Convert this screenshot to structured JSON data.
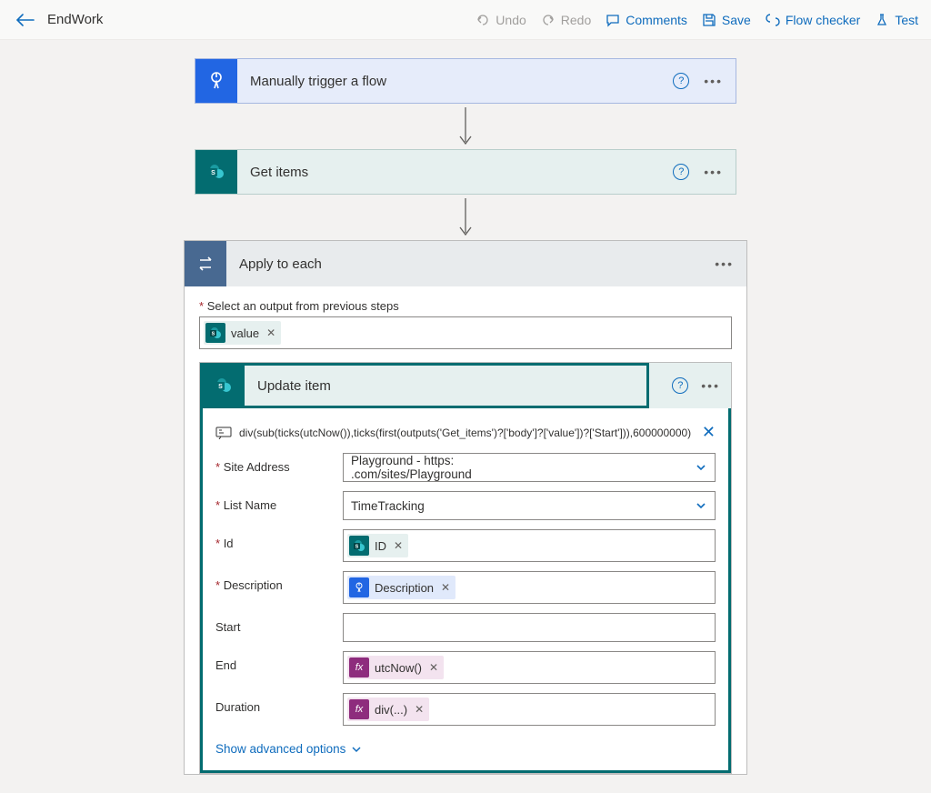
{
  "header": {
    "flow_name": "EndWork",
    "undo": "Undo",
    "redo": "Redo",
    "comments": "Comments",
    "save": "Save",
    "flow_checker": "Flow checker",
    "test": "Test"
  },
  "trigger": {
    "title": "Manually trigger a flow"
  },
  "get_items": {
    "title": "Get items"
  },
  "apply_each": {
    "title": "Apply to each",
    "select_label": "Select an output from previous steps",
    "value_token": "value"
  },
  "update_item": {
    "title": "Update item",
    "peek_expr": "div(sub(ticks(utcNow()),ticks(first(outputs('Get_items')?['body']?['value'])?['Start'])),600000000)",
    "labels": {
      "site": "Site Address",
      "list": "List Name",
      "id": "Id",
      "desc": "Description",
      "start": "Start",
      "end": "End",
      "duration": "Duration"
    },
    "values": {
      "site_left": "Playground - https:",
      "site_right": ".com/sites/Playground",
      "list": "TimeTracking",
      "id_token": "ID",
      "desc_token": "Description",
      "end_token": "utcNow()",
      "duration_token": "div(...)"
    },
    "advanced": "Show advanced options"
  }
}
